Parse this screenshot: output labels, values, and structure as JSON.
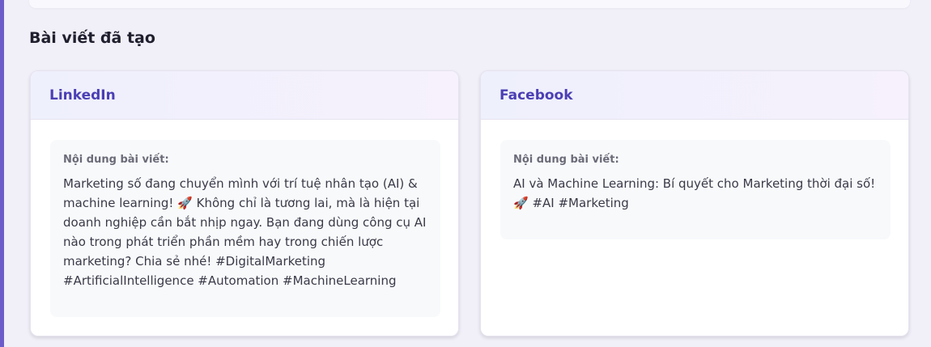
{
  "section": {
    "title": "Bài viết đã tạo"
  },
  "posts": [
    {
      "platform": "LinkedIn",
      "content_label": "Nội dung bài viết:",
      "content": "Marketing số đang chuyển mình với trí tuệ nhân tạo (AI) & machine learning! 🚀 Không chỉ là tương lai, mà là hiện tại doanh nghiệp cần bắt nhịp ngay. Bạn đang dùng công cụ AI nào trong phát triển phần mềm hay trong chiến lược marketing? Chia sẻ nhé! #DigitalMarketing #ArtificialIntelligence #Automation #MachineLearning"
    },
    {
      "platform": "Facebook",
      "content_label": "Nội dung bài viết:",
      "content": "AI và Machine Learning: Bí quyết cho Marketing thời đại số! 🚀 #AI #Marketing"
    }
  ],
  "colors": {
    "accent": "#6b5cc9",
    "card_title": "#4b3fb4",
    "background": "#f1eff8"
  }
}
